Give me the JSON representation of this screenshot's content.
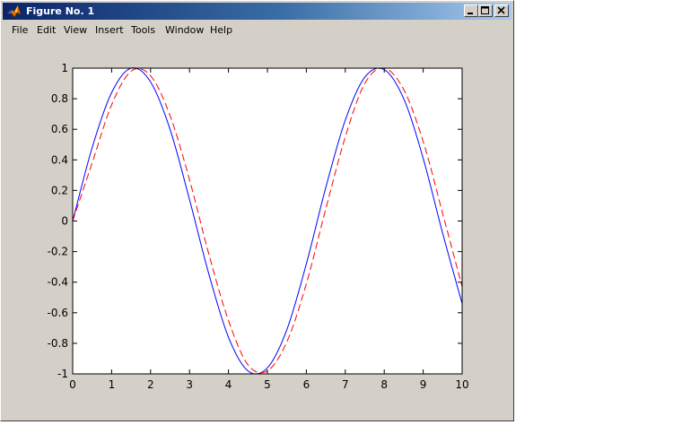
{
  "window": {
    "title": "Figure No. 1",
    "icon": "matlab-logo-icon",
    "controls": {
      "minimize": "minimize-icon",
      "maximize": "maximize-icon",
      "close": "close-icon"
    }
  },
  "menu": {
    "items": [
      {
        "label": "File"
      },
      {
        "label": "Edit"
      },
      {
        "label": "View"
      },
      {
        "label": "Insert"
      },
      {
        "label": "Tools"
      },
      {
        "label": "Window"
      },
      {
        "label": "Help"
      }
    ]
  },
  "colors": {
    "title_gradient_start": "#0a246a",
    "title_gradient_end": "#a6caf0",
    "figure_background": "#d4d0c8",
    "axes_background": "#ffffff",
    "series_solid": "#0000ff",
    "series_dashed": "#ff0000"
  },
  "chart_data": {
    "type": "line",
    "title": "",
    "xlabel": "",
    "ylabel": "",
    "xlim": [
      0,
      10
    ],
    "ylim": [
      -1,
      1
    ],
    "xticks": [
      "0",
      "1",
      "2",
      "3",
      "4",
      "5",
      "6",
      "7",
      "8",
      "9",
      "10"
    ],
    "yticks": [
      "-1",
      "-0.8",
      "-0.6",
      "-0.4",
      "-0.2",
      "0",
      "0.2",
      "0.4",
      "0.6",
      "0.8",
      "1"
    ],
    "grid": false,
    "legend": false,
    "series": [
      {
        "style": "solid",
        "color": "#0000ff",
        "x": [
          0,
          0.5,
          1,
          1.5,
          2,
          2.5,
          3,
          3.5,
          4,
          4.5,
          5,
          5.5,
          6,
          6.5,
          7,
          7.5,
          8,
          8.5,
          9,
          9.5,
          10
        ],
        "y": [
          0,
          0.48,
          0.84,
          1.0,
          0.91,
          0.6,
          0.14,
          -0.35,
          -0.76,
          -0.98,
          -0.96,
          -0.71,
          -0.28,
          0.22,
          0.66,
          0.94,
          0.99,
          0.8,
          0.41,
          -0.08,
          -0.54
        ]
      },
      {
        "style": "dashed",
        "color": "#ff0000",
        "x": [
          0,
          0.5,
          1,
          1.5,
          2,
          2.5,
          3,
          3.5,
          4,
          4.5,
          5,
          5.5,
          6,
          6.5,
          7,
          7.5,
          8,
          8.5,
          9,
          9.5,
          10
        ],
        "y": [
          0,
          0.38,
          0.76,
          0.98,
          0.95,
          0.69,
          0.27,
          -0.22,
          -0.65,
          -0.94,
          -0.98,
          -0.79,
          -0.41,
          0.08,
          0.55,
          0.9,
          1.0,
          0.86,
          0.52,
          0.05,
          -0.43
        ]
      }
    ]
  }
}
